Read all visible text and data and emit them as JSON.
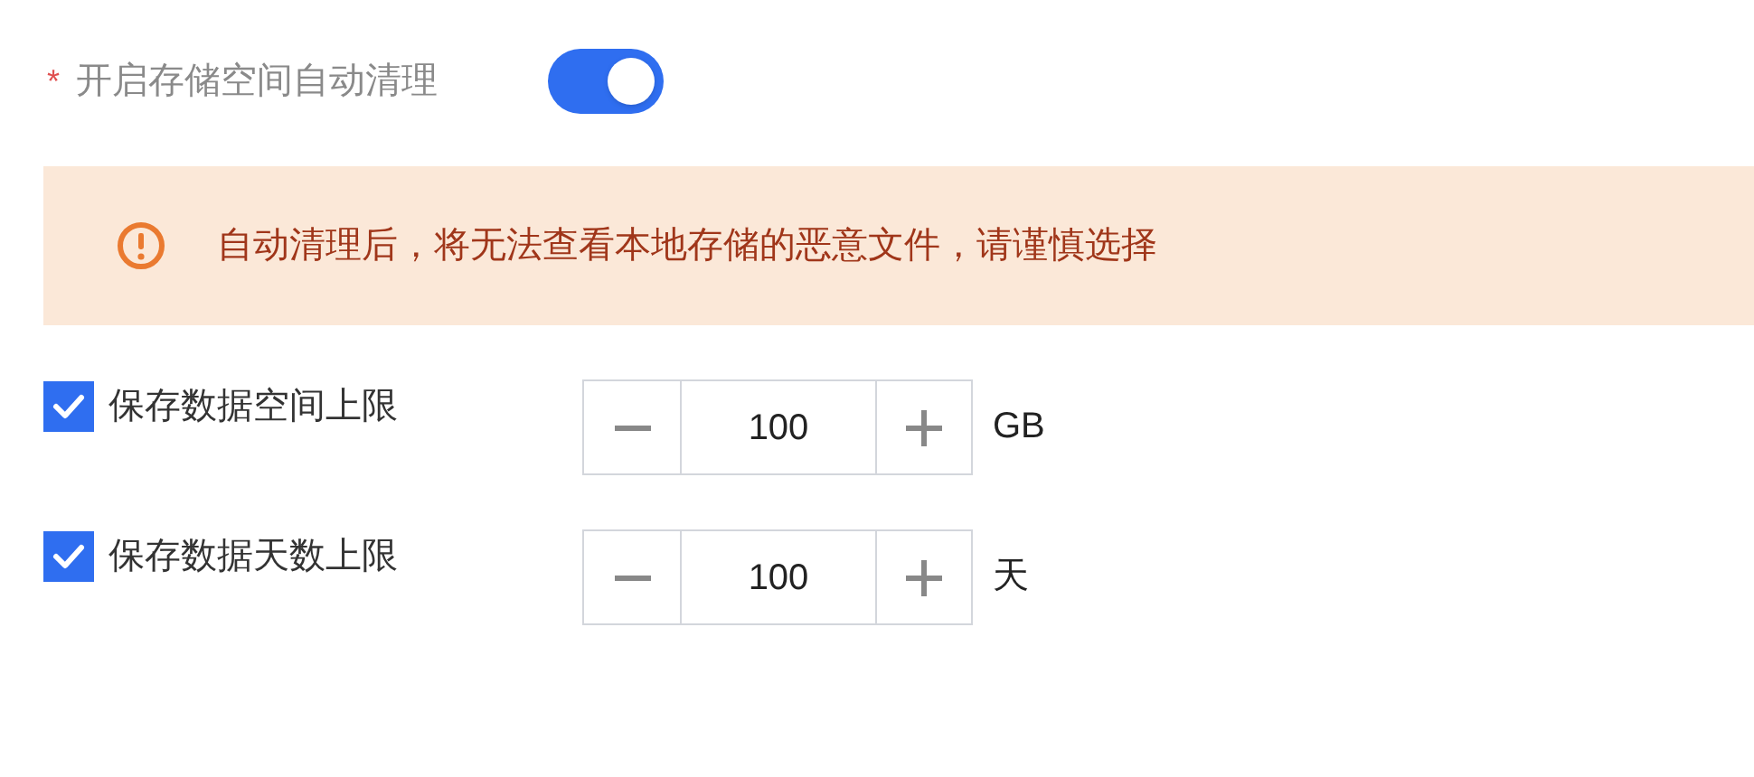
{
  "auto_clean": {
    "required_mark": "*",
    "label": "开启存储空间自动清理",
    "on": true
  },
  "alert": {
    "message": "自动清理后，将无法查看本地存储的恶意文件，请谨慎选择"
  },
  "limits": [
    {
      "label": "保存数据空间上限",
      "checked": true,
      "value": "100",
      "unit": "GB"
    },
    {
      "label": "保存数据天数上限",
      "checked": true,
      "value": "100",
      "unit": "天"
    }
  ]
}
